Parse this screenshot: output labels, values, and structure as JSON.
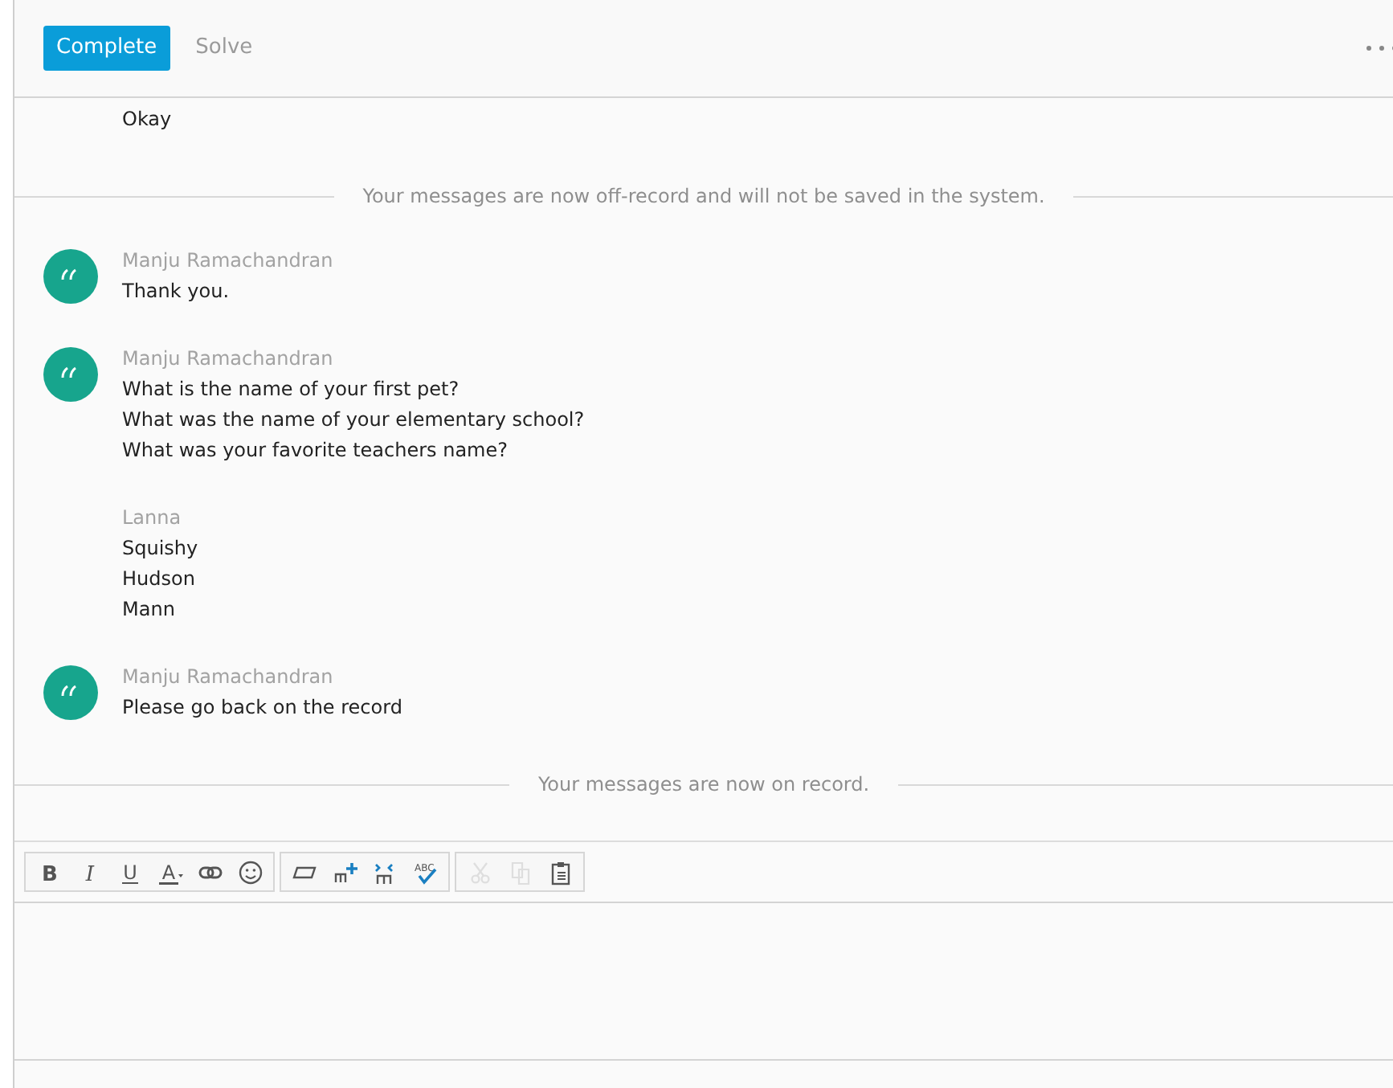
{
  "header": {
    "buttons": [
      {
        "label": "Complete",
        "selected": true
      },
      {
        "label": "Solve",
        "selected": false
      }
    ]
  },
  "transcript": [
    {
      "kind": "message",
      "avatar": false,
      "lines": [
        "Okay"
      ]
    },
    {
      "kind": "notice",
      "text": "Your messages are now off-record and will not be saved in the system."
    },
    {
      "kind": "message",
      "avatar": true,
      "sender": "Manju Ramachandran",
      "lines": [
        "Thank you."
      ]
    },
    {
      "kind": "message",
      "avatar": true,
      "sender": "Manju Ramachandran",
      "lines": [
        "What is the name of your first pet?",
        "What was the name of your elementary school?",
        "What was your favorite teachers name?"
      ]
    },
    {
      "kind": "message",
      "avatar": false,
      "sender": "Lanna",
      "lines": [
        "Squishy",
        "Hudson",
        "Mann"
      ]
    },
    {
      "kind": "message",
      "avatar": true,
      "sender": "Manju Ramachandran",
      "lines": [
        "Please go back on the record"
      ]
    },
    {
      "kind": "notice",
      "text": "Your messages are now on record."
    }
  ],
  "toolbar": {
    "groups": [
      [
        {
          "glyph": "B",
          "disabled": false
        },
        {
          "glyph": "I",
          "disabled": false
        },
        {
          "glyph": "U",
          "disabled": false
        },
        {
          "glyph": "A",
          "disabled": false
        },
        {
          "disabled": false
        },
        {
          "disabled": false
        }
      ],
      [
        {
          "disabled": false
        },
        {
          "disabled": false
        },
        {
          "disabled": false
        },
        {
          "glyph": "ABC",
          "disabled": false
        }
      ],
      [
        {
          "disabled": true
        },
        {
          "disabled": true
        },
        {
          "disabled": false
        }
      ]
    ]
  }
}
